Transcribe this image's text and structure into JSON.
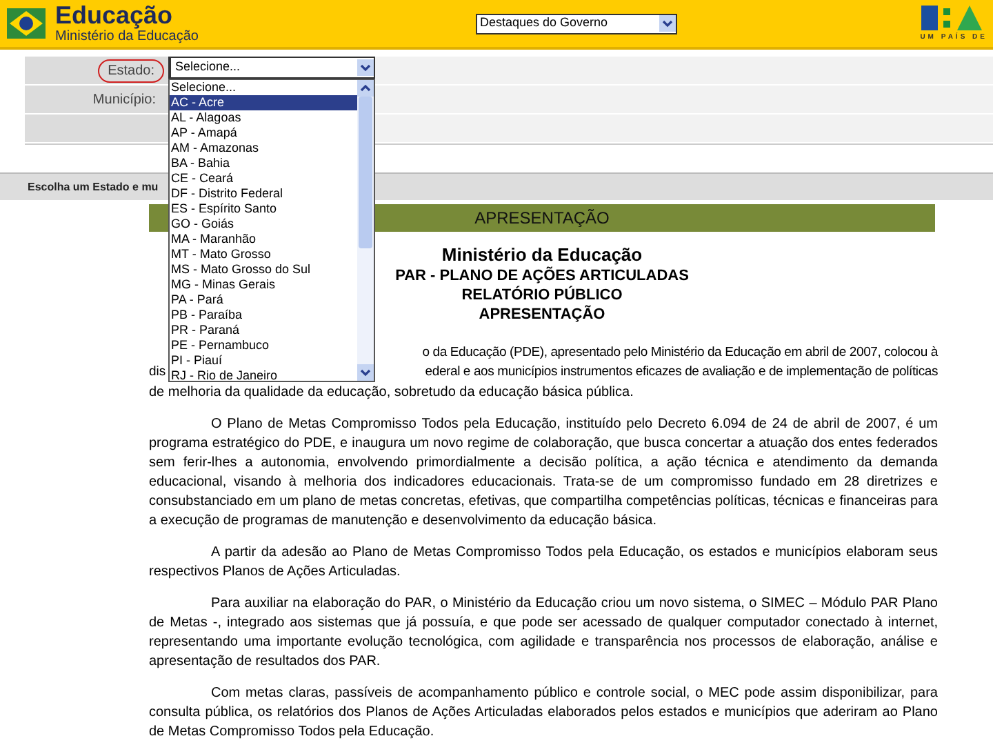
{
  "header": {
    "title": "Educação",
    "subtitle": "Ministério da Educação",
    "select_value": "Destaques do Governo",
    "logo_tagline": "UM PAÍS DE"
  },
  "form": {
    "fields": [
      {
        "label": "Estado:",
        "value": "Selecione...",
        "highlighted": true
      },
      {
        "label": "Município:",
        "highlighted": false
      }
    ]
  },
  "dropdown": {
    "options": [
      {
        "label": "Selecione...",
        "selected": false
      },
      {
        "label": "AC - Acre",
        "selected": true
      },
      {
        "label": "AL - Alagoas",
        "selected": false
      },
      {
        "label": "AP - Amapá",
        "selected": false
      },
      {
        "label": "AM - Amazonas",
        "selected": false
      },
      {
        "label": "BA - Bahia",
        "selected": false
      },
      {
        "label": "CE - Ceará",
        "selected": false
      },
      {
        "label": "DF - Distrito Federal",
        "selected": false
      },
      {
        "label": "ES - Espírito Santo",
        "selected": false
      },
      {
        "label": "GO - Goiás",
        "selected": false
      },
      {
        "label": "MA - Maranhão",
        "selected": false
      },
      {
        "label": "MT - Mato Grosso",
        "selected": false
      },
      {
        "label": "MS - Mato Grosso do Sul",
        "selected": false
      },
      {
        "label": "MG - Minas Gerais",
        "selected": false
      },
      {
        "label": "PA - Pará",
        "selected": false
      },
      {
        "label": "PB - Paraíba",
        "selected": false
      },
      {
        "label": "PR - Paraná",
        "selected": false
      },
      {
        "label": "PE - Pernambuco",
        "selected": false
      },
      {
        "label": "PI - Piauí",
        "selected": false
      },
      {
        "label": "RJ - Rio de Janeiro",
        "selected": false
      }
    ]
  },
  "section_bar": "Escolha um Estado e mu",
  "banner": "APRESENTAÇÃO",
  "headings": [
    "Ministério da Educação",
    "PAR - PLANO DE AÇÕES ARTICULADAS",
    "RELATÓRIO PÚBLICO",
    "APRESENTAÇÃO"
  ],
  "first_paragraph_fragments": {
    "line_1": "o da Educação (PDE), apresentado pelo Ministério da Educação em abril de 2007, colocou à",
    "line_2_start": "dis",
    "line_2_end": "ederal e aos municípios instrumentos eficazes de avaliação e de implementação de políticas",
    "line_3": "de melhoria da qualidade da educação, sobretudo da educação básica pública."
  },
  "paragraphs": [
    "O Plano de Metas Compromisso Todos pela Educação, instituído pelo Decreto 6.094 de 24 de abril de 2007, é um programa estratégico do PDE, e inaugura um novo regime de colaboração, que busca concertar a atuação dos entes federados sem ferir-lhes a autonomia, envolvendo primordialmente a decisão política, a ação técnica e atendimento da demanda educacional, visando à melhoria dos indicadores educacionais. Trata-se de um compromisso fundado em 28 diretrizes e consubstanciado em um plano de metas concretas, efetivas, que compartilha competências políticas, técnicas e financeiras para a execução de programas de manutenção e desenvolvimento da educação básica.",
    "A partir da adesão ao Plano de Metas Compromisso Todos pela Educação, os estados e municípios elaboram seus respectivos Planos de Ações Articuladas.",
    "Para auxiliar na elaboração do PAR, o Ministério da Educação criou um novo sistema, o SIMEC – Módulo PAR Plano de Metas -, integrado aos sistemas que já possuía, e que pode ser acessado de qualquer computador conectado à internet, representando uma importante evolução tecnológica, com agilidade e transparência nos processos de elaboração, análise e apresentação de resultados dos PAR.",
    "Com metas claras, passíveis de acompanhamento público e controle social, o MEC pode assim disponibilizar, para consulta pública, os relatórios dos Planos de Ações Articuladas elaborados pelos estados e municípios que aderiram ao Plano de Metas Compromisso Todos pela Educação."
  ]
}
